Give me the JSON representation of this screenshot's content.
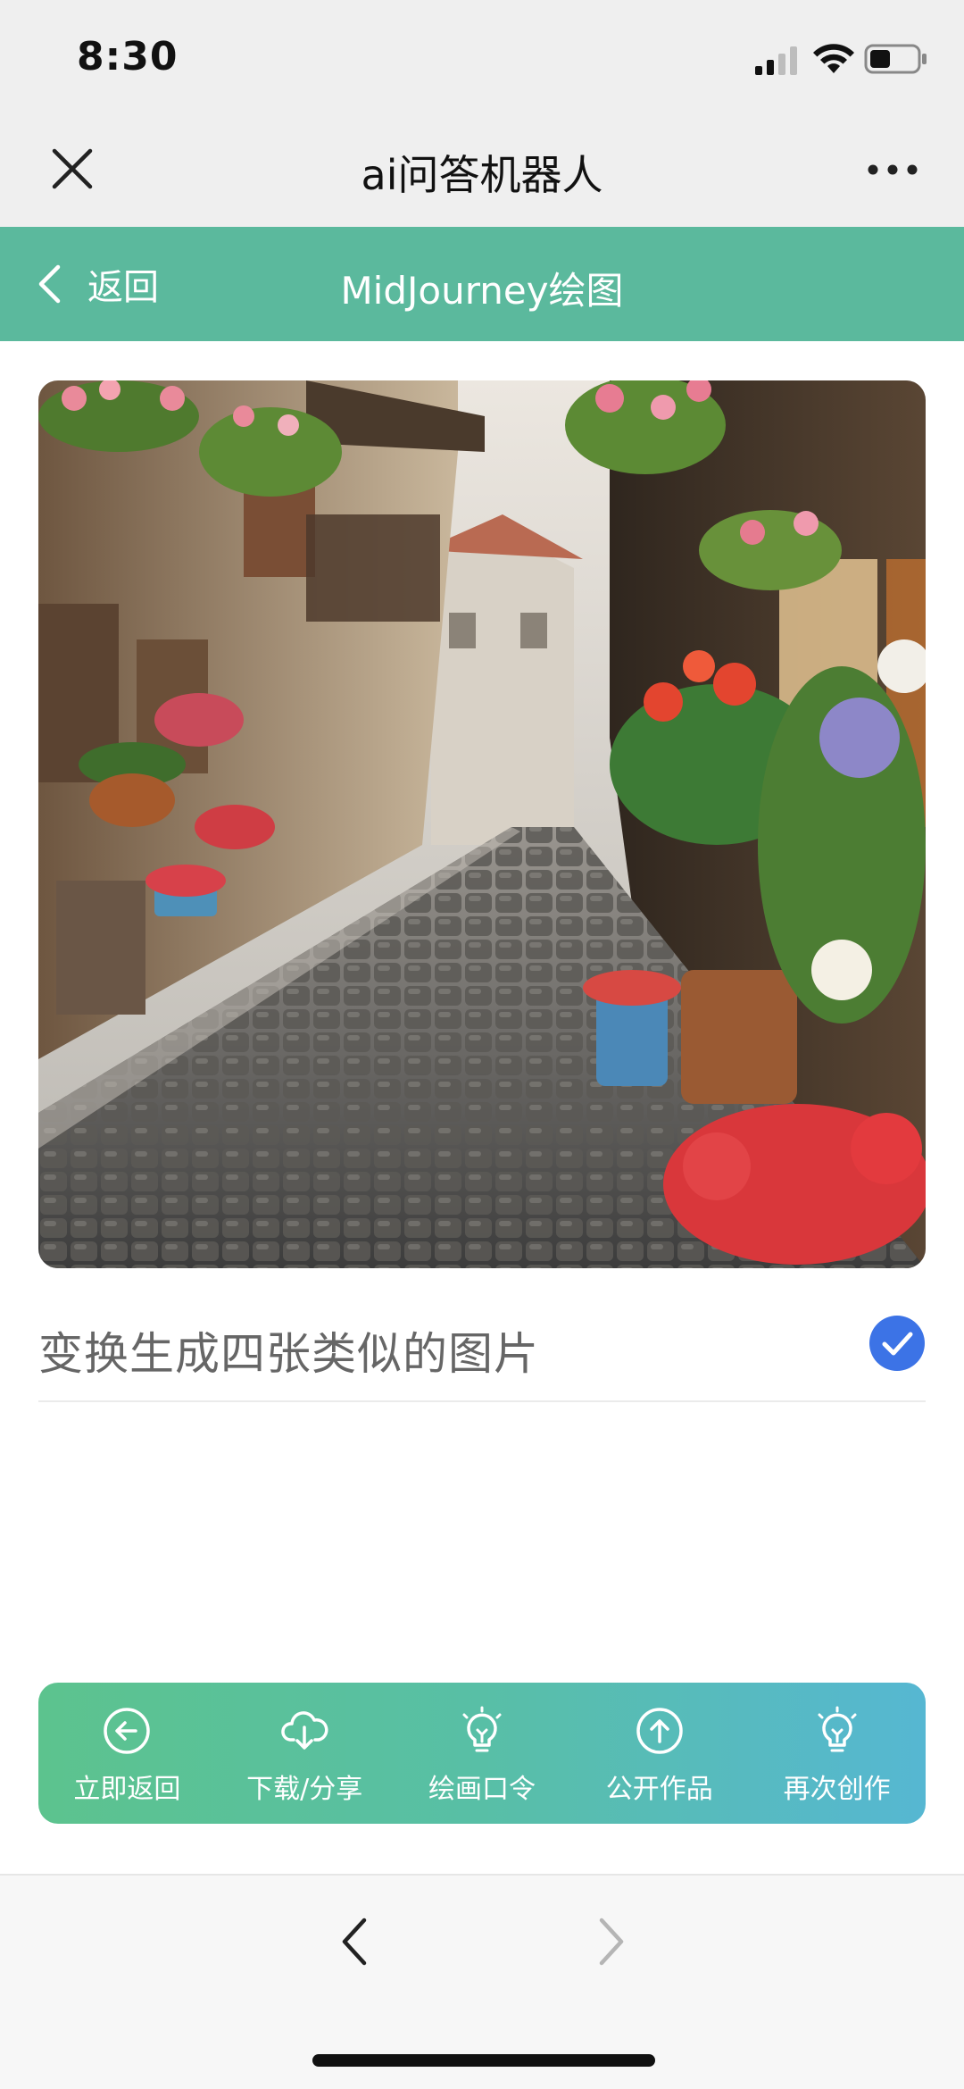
{
  "status_bar": {
    "time": "8:30",
    "icons": [
      "signal-icon",
      "wifi-icon",
      "battery-icon"
    ]
  },
  "app_bar": {
    "title": "ai问答机器人",
    "left_icon": "close-icon",
    "right_icon": "more-icon"
  },
  "nav_header": {
    "back_label": "返回",
    "title": "MidJourney绘图",
    "background": "#5bb99d"
  },
  "option": {
    "label": "变换生成四张类似的图片",
    "checked": true,
    "check_color": "#3c73e6"
  },
  "actions": [
    {
      "label": "立即返回",
      "icon": "back-circle-icon"
    },
    {
      "label": "下载/分享",
      "icon": "cloud-download-icon"
    },
    {
      "label": "绘画口令",
      "icon": "lightbulb-icon"
    },
    {
      "label": "公开作品",
      "icon": "upload-circle-icon"
    },
    {
      "label": "再次创作",
      "icon": "lightbulb-icon"
    }
  ],
  "browser_bar": {
    "back_icon": "chevron-left-icon",
    "forward_icon": "chevron-right-icon"
  }
}
